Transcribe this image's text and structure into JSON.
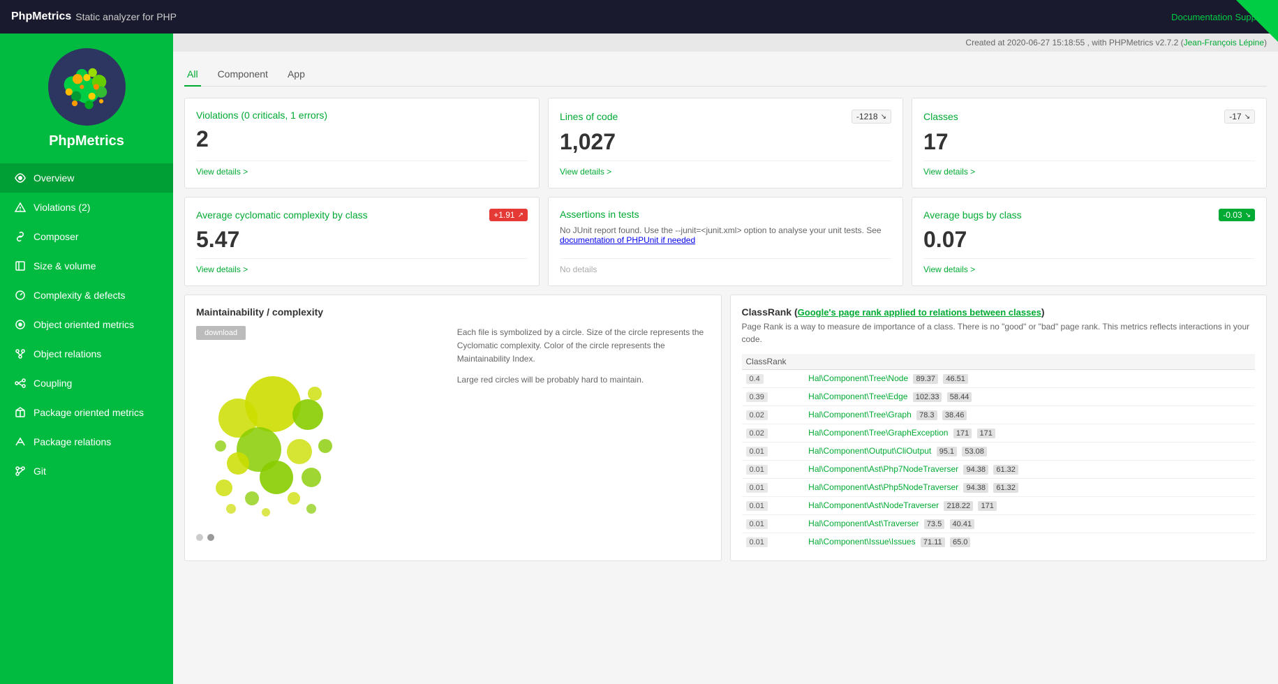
{
  "topbar": {
    "brand": "PhpMetrics",
    "subtitle": "Static analyzer for PHP",
    "docs_label": "Documentation",
    "support_label": "Support"
  },
  "meta": {
    "created": "Created at 2020-06-27 15:18:55 , with PHPMetrics v2.7.2 (",
    "author": "Jean-François Lépine",
    "created_end": ")"
  },
  "tabs": [
    {
      "id": "all",
      "label": "All",
      "active": true
    },
    {
      "id": "component",
      "label": "Component",
      "active": false
    },
    {
      "id": "app",
      "label": "App",
      "active": false
    }
  ],
  "cards": [
    {
      "id": "violations",
      "title": "Violations (0 criticals, 1 errors)",
      "value": "2",
      "badge": null,
      "footer": "View details >",
      "desc": null
    },
    {
      "id": "loc",
      "title": "Lines of code",
      "value": "1,027",
      "badge": {
        "text": "-1218",
        "type": "neutral",
        "icon": "↘"
      },
      "footer": "View details >",
      "desc": null
    },
    {
      "id": "classes",
      "title": "Classes",
      "value": "17",
      "badge": {
        "text": "-17",
        "type": "neutral",
        "icon": "↘"
      },
      "footer": "View details >",
      "desc": null
    },
    {
      "id": "cyclomatic",
      "title": "Average cyclomatic complexity by class",
      "value": "5.47",
      "badge": {
        "text": "+1.91",
        "type": "red",
        "icon": "↗"
      },
      "footer": "View details >",
      "desc": null
    },
    {
      "id": "assertions",
      "title": "Assertions in tests",
      "value": null,
      "badge": null,
      "footer": "No details",
      "desc": "No JUnit report found. Use the --junit=<junit.xml> option to analyse your unit tests. See documentation of PHPUnit if needed"
    },
    {
      "id": "bugs",
      "title": "Average bugs by class",
      "value": "0.07",
      "badge": {
        "text": "-0.03",
        "type": "green",
        "icon": "↘"
      },
      "footer": "View details >",
      "desc": null
    }
  ],
  "maintainability": {
    "title": "Maintainability / complexity",
    "download_btn": "download",
    "desc1": "Each file is symbolized by a circle. Size of the circle represents the Cyclomatic complexity. Color of the circle represents the Maintainability Index.",
    "desc2": "Large red circles will be probably hard to maintain."
  },
  "classrank": {
    "title": "ClassRank",
    "link_label": "Google's page rank applied to relations between classes",
    "subtitle": "Page Rank is a way to measure de importance of a class. There is no \"good\" or \"bad\" page rank. This metrics reflects interactions in your code.",
    "col": "ClassRank",
    "rows": [
      {
        "rank": "0.4",
        "class": "Hal\\Component\\Tree\\Node",
        "v1": "89.37",
        "v2": "46.51"
      },
      {
        "rank": "0.39",
        "class": "Hal\\Component\\Tree\\Edge",
        "v1": "102.33",
        "v2": "58.44"
      },
      {
        "rank": "0.02",
        "class": "Hal\\Component\\Tree\\Graph",
        "v1": "78.3",
        "v2": "38.46"
      },
      {
        "rank": "0.02",
        "class": "Hal\\Component\\Tree\\GraphException",
        "v1": "171",
        "v2": "171"
      },
      {
        "rank": "0.01",
        "class": "Hal\\Component\\Output\\CliOutput",
        "v1": "95.1",
        "v2": "53.08"
      },
      {
        "rank": "0.01",
        "class": "Hal\\Component\\Ast\\Php7NodeTraverser",
        "v1": "94.38",
        "v2": "61.32"
      },
      {
        "rank": "0.01",
        "class": "Hal\\Component\\Ast\\Php5NodeTraverser",
        "v1": "94.38",
        "v2": "61.32"
      },
      {
        "rank": "0.01",
        "class": "Hal\\Component\\Ast\\NodeTraverser",
        "v1": "218.22",
        "v2": "171"
      },
      {
        "rank": "0.01",
        "class": "Hal\\Component\\Ast\\Traverser",
        "v1": "73.5",
        "v2": "40.41"
      },
      {
        "rank": "0.01",
        "class": "Hal\\Component\\Issue\\Issues",
        "v1": "71.11",
        "v2": "65.0"
      }
    ]
  },
  "sidebar": {
    "logo_alt": "PhpMetrics Logo",
    "title": "PhpMetrics",
    "items": [
      {
        "id": "overview",
        "label": "Overview",
        "icon": "eye"
      },
      {
        "id": "violations",
        "label": "Violations (2)",
        "icon": "alert"
      },
      {
        "id": "composer",
        "label": "Composer",
        "icon": "link"
      },
      {
        "id": "size-volume",
        "label": "Size & volume",
        "icon": "resize"
      },
      {
        "id": "complexity-defects",
        "label": "Complexity & defects",
        "icon": "dial"
      },
      {
        "id": "object-oriented",
        "label": "Object oriented metrics",
        "icon": "circle-dot"
      },
      {
        "id": "object-relations",
        "label": "Object relations",
        "icon": "branch"
      },
      {
        "id": "coupling",
        "label": "Coupling",
        "icon": "node"
      },
      {
        "id": "package-oriented",
        "label": "Package oriented metrics",
        "icon": "package"
      },
      {
        "id": "package-relations",
        "label": "Package relations",
        "icon": "package-branch"
      },
      {
        "id": "git",
        "label": "Git",
        "icon": "git"
      }
    ]
  }
}
